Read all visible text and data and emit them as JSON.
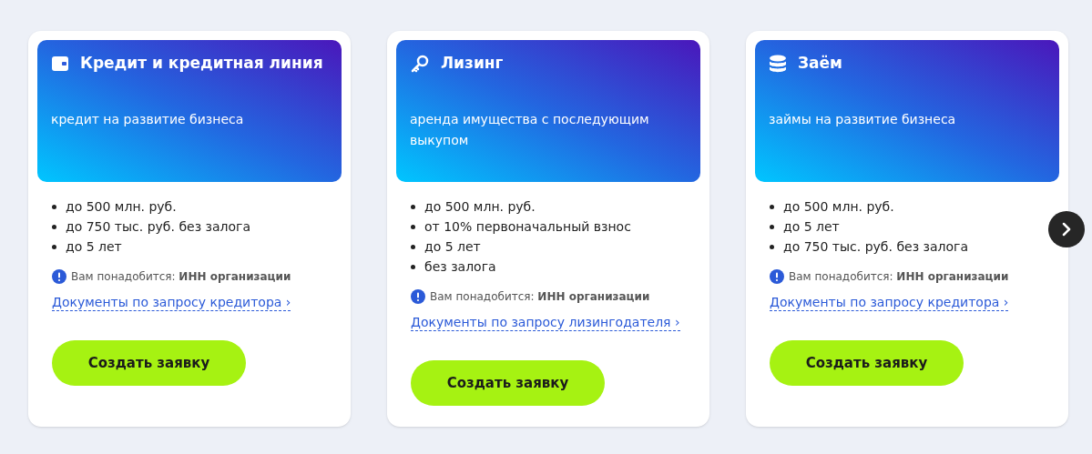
{
  "cards": [
    {
      "kind": "credit",
      "title": "Кредит и кредитная линия",
      "subtitle": "кредит на развитие бизнеса",
      "features": [
        "до 500 млн. руб.",
        "до 750 тыс. руб. без залога",
        "до 5 лет"
      ],
      "note": "Вам понадобится: **ИНН организации**",
      "link": "Документы по запросу кредитора ›",
      "button": "Создать заявку"
    },
    {
      "kind": "leasing",
      "title": "Лизинг",
      "subtitle": "аренда имущества с последующим выкупом",
      "features": [
        "до 500 млн. руб.",
        "от 10% первоначальный взнос",
        "до 5 лет",
        "без залога"
      ],
      "note": "Вам понадобится: **ИНН организации**",
      "link": "Документы по запросу лизингодателя ›",
      "button": "Создать заявку"
    },
    {
      "kind": "loan",
      "title": "Заём",
      "subtitle": "займы на развитие бизнеса",
      "features": [
        "до 500 млн. руб.",
        "до 5 лет",
        "до 750 тыс. руб. без залога"
      ],
      "note": "Вам понадобится: **ИНН организации**",
      "link": "Документы по запросу кредитора ›",
      "button": "Создать заявку"
    }
  ]
}
